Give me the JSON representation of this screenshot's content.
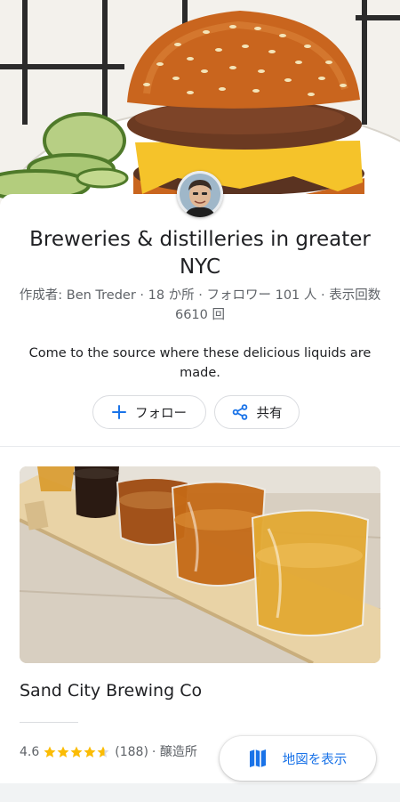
{
  "list": {
    "title": "Breweries & distilleries in greater NYC",
    "meta": "作成者: Ben Treder · 18 か所 · フォロワー 101 人 · 表示回数 6610 回",
    "description": "Come to the source where these delicious liquids are made.",
    "follow_label": "フォロー",
    "share_label": "共有"
  },
  "place": {
    "name": "Sand City Brewing Co",
    "rating": "4.6",
    "rating_value": 4.6,
    "review_count": "(188)",
    "category": "· 醸造所"
  },
  "map_button_label": "地図を表示",
  "colors": {
    "accent": "#1a73e8",
    "star": "#fbbc04",
    "text_primary": "#202124",
    "text_secondary": "#5f6368"
  },
  "icons": {
    "follow": "plus-icon",
    "share": "share-icon",
    "map": "map-icon",
    "rating": "star-icon"
  }
}
